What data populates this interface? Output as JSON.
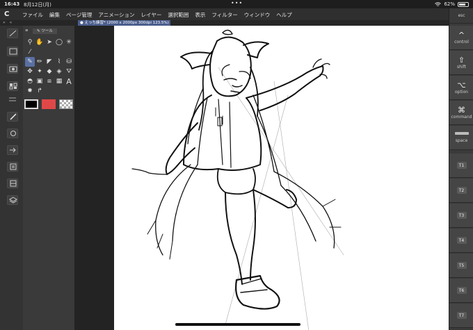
{
  "status": {
    "time": "16:43",
    "date": "8月12日(月)",
    "battery": "62%",
    "battery_level": 0.62,
    "dots": "•••"
  },
  "app": {
    "logo": "C"
  },
  "menu": [
    "ファイル",
    "編集",
    "ページ管理",
    "アニメーション",
    "レイヤー",
    "選択範囲",
    "表示",
    "フィルター",
    "ウィンドウ",
    "ヘルプ"
  ],
  "tabrow": {
    "arrows": "» «"
  },
  "document_tab": {
    "title": "● えっち練習* (2000 x 2000px 300dpi 123.5%)"
  },
  "tool_panel": {
    "title": "ツール",
    "text_tool_glyph": "A"
  },
  "colors": {
    "main": "#000000",
    "sub": "#e04848"
  },
  "right_keys": {
    "esc": "esc",
    "control": {
      "glyph": "^",
      "label": "control"
    },
    "shift": {
      "glyph": "⇧",
      "label": "shift"
    },
    "option": {
      "glyph": "⌥",
      "label": "option"
    },
    "command": {
      "glyph": "⌘",
      "label": "command"
    },
    "space": {
      "label": "space"
    },
    "t": [
      "T1",
      "T2",
      "T3",
      "T4",
      "T5",
      "T6",
      "T7"
    ]
  }
}
